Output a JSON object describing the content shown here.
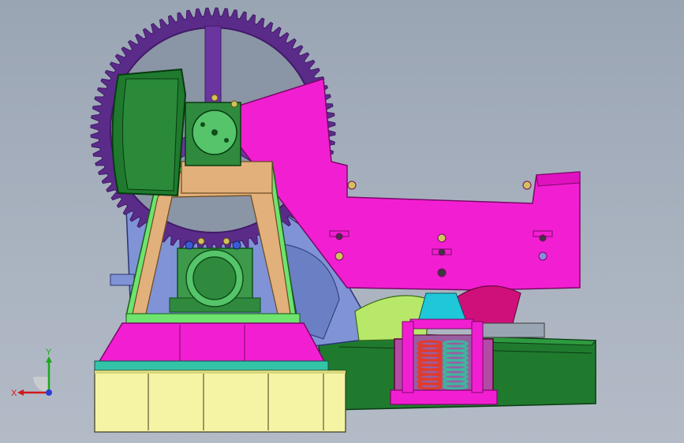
{
  "viewport": {
    "background": "#a3adba"
  },
  "colors": {
    "gear": "#5b2b8a",
    "gear_dark": "#3f1a66",
    "gear_web": "#6a35a0",
    "motor": "#1f7a2e",
    "motor_dark": "#0f4f1a",
    "motor_light": "#56c46a",
    "frame_tan": "#e2b07a",
    "frame_green": "#6ee46e",
    "magenta": "#f21fd2",
    "magenta_dark": "#b0109a",
    "blue_body": "#7f93d6",
    "base_yellow": "#f4f4a4",
    "base_teal": "#33c4a8",
    "spring_red": "#e23a2a",
    "spring_teal": "#3fb4a0",
    "rail": "#1f7a2e",
    "cyan": "#3ad4e8",
    "olive": "#b8e86a"
  },
  "triad": {
    "x_label": "X",
    "y_label": "Y",
    "icon": "coordinate-triad-icon"
  }
}
